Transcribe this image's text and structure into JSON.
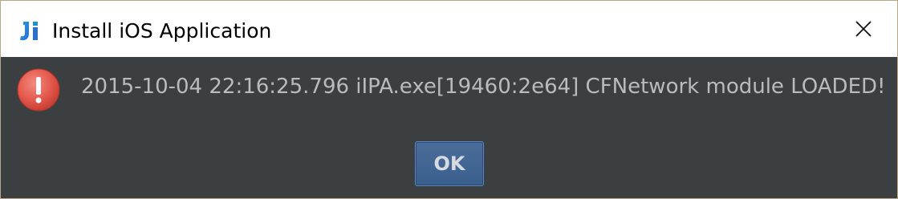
{
  "window": {
    "title": "Install iOS Application",
    "app_icon": "intellij-idea-icon",
    "close_icon": "close-icon"
  },
  "dialog": {
    "icon": "error-icon",
    "message": "2015-10-04 22:16:25.796 iIPA.exe[19460:2e64] CFNetwork module LOADED!",
    "ok_label": "OK"
  },
  "colors": {
    "titlebar_bg": "#ffffff",
    "dialog_bg": "#3c3f41",
    "message_text": "#b9bcbe",
    "button_bg": "#41638f",
    "error_red": "#e05a50"
  }
}
